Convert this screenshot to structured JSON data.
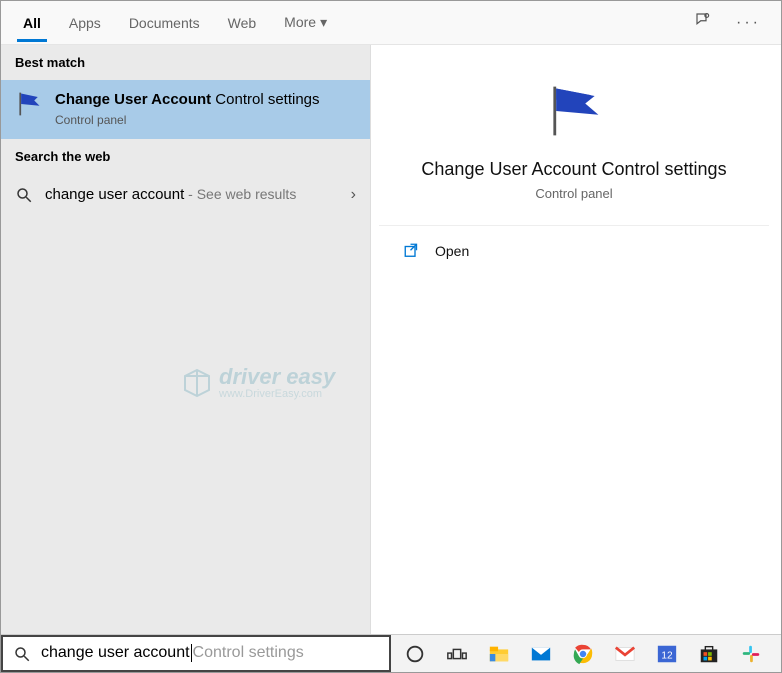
{
  "tabs": {
    "all": "All",
    "apps": "Apps",
    "documents": "Documents",
    "web": "Web",
    "more": "More"
  },
  "sections": {
    "best_match": "Best match",
    "search_web": "Search the web"
  },
  "best_match": {
    "title_bold": "Change User Account",
    "title_rest": " Control settings",
    "subtitle": "Control panel"
  },
  "web_result": {
    "query": "change user account",
    "suffix": " - See web results"
  },
  "detail": {
    "title": "Change User Account Control settings",
    "subtitle": "Control panel",
    "open_label": "Open"
  },
  "search": {
    "value": "change user account",
    "placeholder_completion": "Control settings"
  },
  "watermark": {
    "text": "driver easy",
    "url": "www.DriverEasy.com"
  },
  "taskbar": {
    "cortana": "cortana",
    "taskview": "taskview",
    "explorer": "file-explorer",
    "mail": "mail",
    "chrome": "chrome",
    "gmail": "gmail",
    "calendar": "calendar-12",
    "store": "store",
    "slack": "slack"
  }
}
